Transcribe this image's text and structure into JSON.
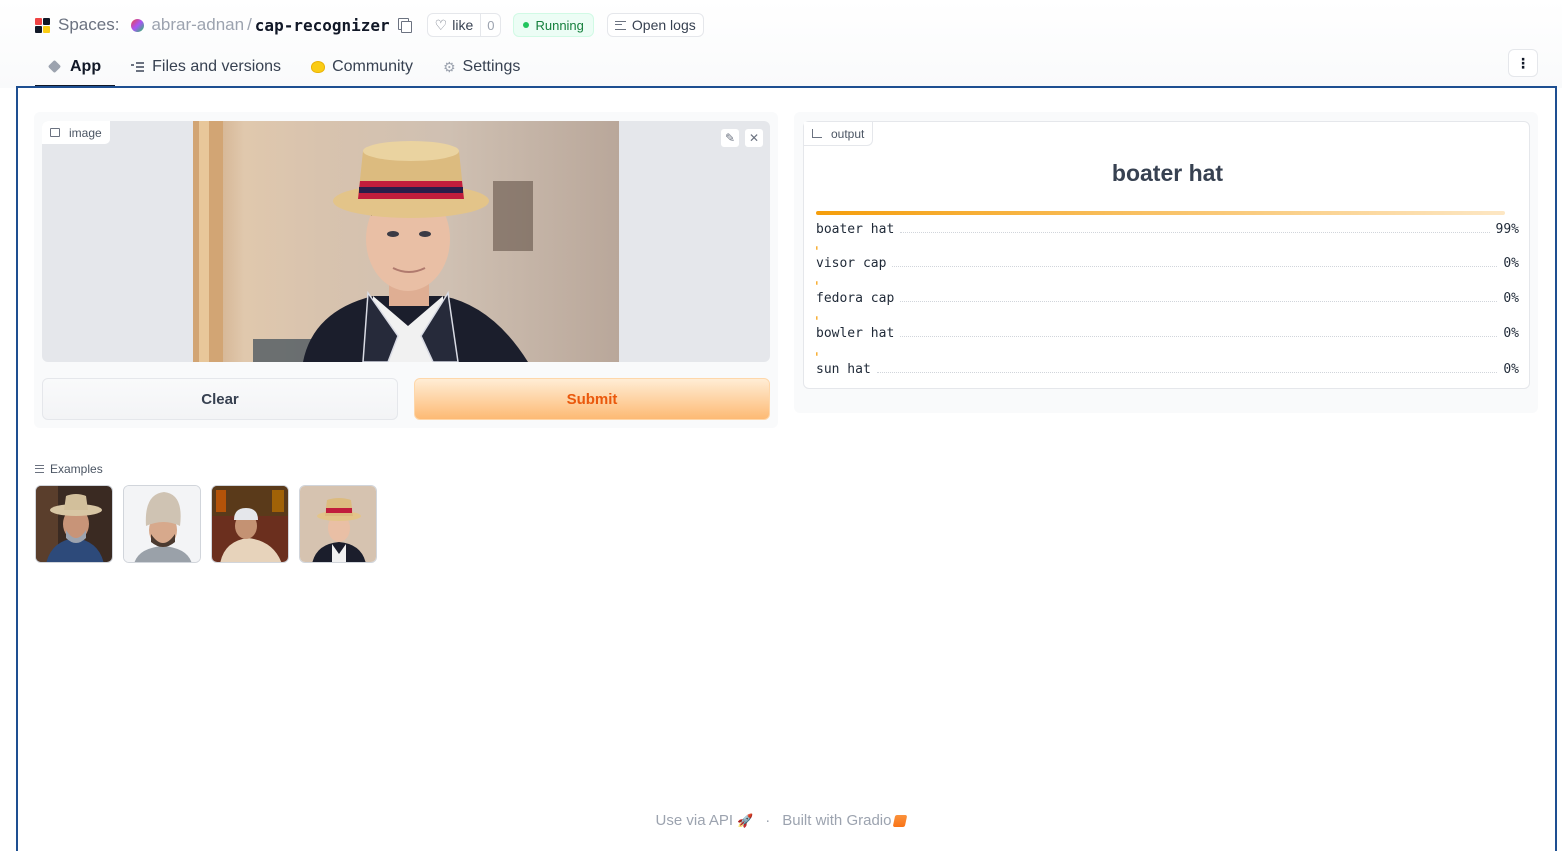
{
  "header": {
    "spaces_label": "Spaces:",
    "owner": "abrar-adnan",
    "separator": "/",
    "repo": "cap-recognizer",
    "like_label": "like",
    "like_count": "0",
    "status": "Running",
    "open_logs": "Open logs",
    "colors": {
      "status": "#15803d",
      "frame_border": "#1e4f91"
    }
  },
  "tabs": [
    {
      "label": "App",
      "icon": "cube-icon",
      "active": true
    },
    {
      "label": "Files and versions",
      "icon": "files-icon",
      "active": false
    },
    {
      "label": "Community",
      "icon": "community-icon",
      "active": false
    },
    {
      "label": "Settings",
      "icon": "gear-icon",
      "active": false
    }
  ],
  "input": {
    "label": "image",
    "buttons": {
      "clear": "Clear",
      "submit": "Submit"
    }
  },
  "output": {
    "label": "output",
    "top_label": "boater hat",
    "confidences": [
      {
        "label": "boater hat",
        "pct": "99%",
        "value": 0.99
      },
      {
        "label": "visor cap",
        "pct": "0%",
        "value": 0.0
      },
      {
        "label": "fedora cap",
        "pct": "0%",
        "value": 0.0
      },
      {
        "label": "bowler hat",
        "pct": "0%",
        "value": 0.0
      },
      {
        "label": "sun hat",
        "pct": "0%",
        "value": 0.0
      }
    ]
  },
  "examples": {
    "label": "Examples"
  },
  "footer": {
    "api": "Use via API",
    "dot": "·",
    "built": "Built with Gradio"
  }
}
